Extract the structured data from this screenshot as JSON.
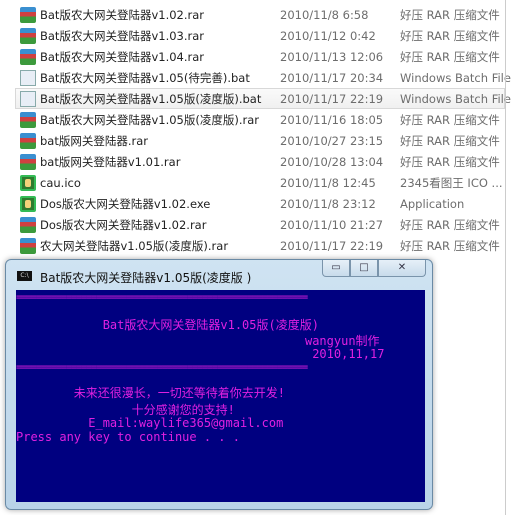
{
  "files": [
    {
      "name": "Bat版农大网关登陆器v1.02.rar",
      "date": "2010/11/8 6:58",
      "type": "好压 RAR 压缩文件",
      "icon": "rar-archive-icon"
    },
    {
      "name": "Bat版农大网关登陆器v1.03.rar",
      "date": "2010/11/12 0:42",
      "type": "好压 RAR 压缩文件",
      "icon": "rar-archive-icon"
    },
    {
      "name": "Bat版农大网关登陆器v1.04.rar",
      "date": "2010/11/13 12:06",
      "type": "好压 RAR 压缩文件",
      "icon": "rar-archive-icon"
    },
    {
      "name": "Bat版农大网关登陆器v1.05(待完善).bat",
      "date": "2010/11/17 20:34",
      "type": "Windows Batch File",
      "icon": "batch-file-icon"
    },
    {
      "name": "Bat版农大网关登陆器v1.05版(凌度版).bat",
      "date": "2010/11/17 22:19",
      "type": "Windows Batch File",
      "icon": "batch-file-icon",
      "selected": true
    },
    {
      "name": "Bat版农大网关登陆器v1.05版(凌度版).rar",
      "date": "2010/11/16 18:05",
      "type": "好压 RAR 压缩文件",
      "icon": "rar-archive-icon"
    },
    {
      "name": "bat版网关登陆器.rar",
      "date": "2010/10/27 23:15",
      "type": "好压 RAR 压缩文件",
      "icon": "rar-archive-icon"
    },
    {
      "name": "bat版网关登陆器v1.01.rar",
      "date": "2010/10/28 13:04",
      "type": "好压 RAR 压缩文件",
      "icon": "rar-archive-icon"
    },
    {
      "name": "cau.ico",
      "date": "2010/11/8 12:45",
      "type": "2345看图王 ICO ...",
      "icon": "image-icon"
    },
    {
      "name": "Dos版农大网关登陆器v1.02.exe",
      "date": "2010/11/8 23:12",
      "type": "Application",
      "icon": "application-icon"
    },
    {
      "name": "Dos版农大网关登陆器v1.02.rar",
      "date": "2010/11/10 21:27",
      "type": "好压 RAR 压缩文件",
      "icon": "rar-archive-icon"
    },
    {
      "name": "农大网关登陆器v1.05版(凌度版).rar",
      "date": "2010/11/17 22:19",
      "type": "好压 RAR 压缩文件",
      "icon": "rar-archive-icon"
    }
  ],
  "console": {
    "title": "Bat版农大网关登陆器v1.05版(凌度版 )",
    "icon_label": "C:\\",
    "buttons": {
      "minimize": "▭",
      "maximize": "□",
      "close": "✕"
    },
    "lines": [
      "==========================================================",
      "            Bat版农大网关登陆器v1.05版(凌度版)",
      "                                        wangyun制作",
      "                                         2010,11,17",
      "==========================================================",
      "        未来还很漫长，一切还等待着你去开发!",
      "                十分感谢您的支持!",
      "          E_mail:waylife365@gmail.com",
      "Press any key to continue . . ."
    ],
    "colors": {
      "background": "#000080",
      "text": "#e020e0"
    }
  }
}
